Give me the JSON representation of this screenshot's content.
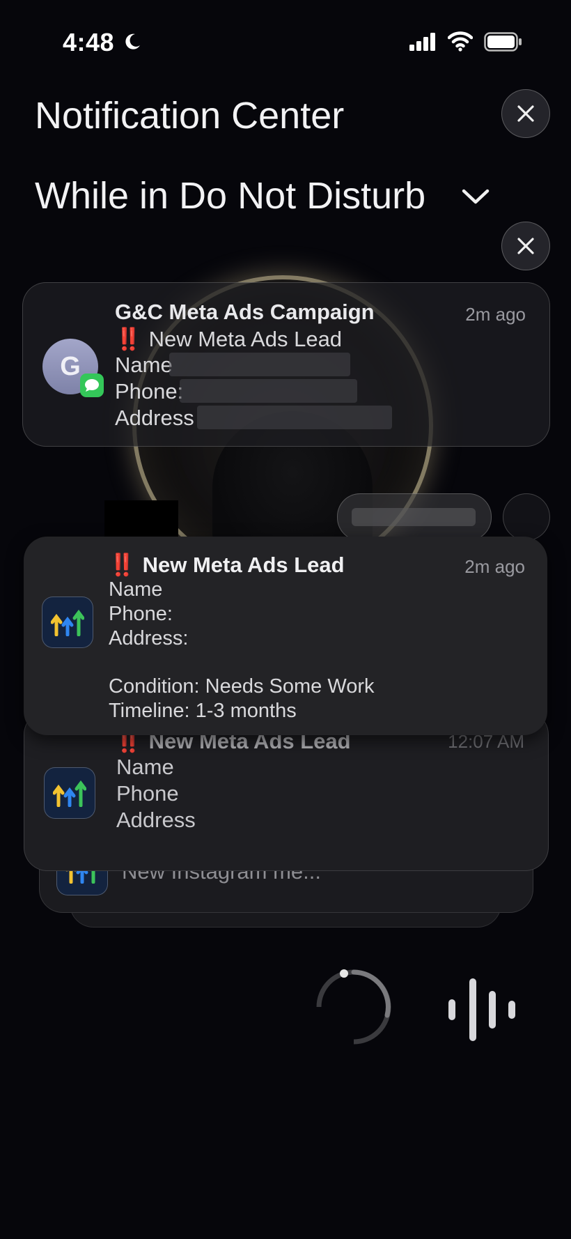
{
  "status_bar": {
    "time": "4:48",
    "focus_icon": "moon-icon",
    "signal_icon": "cellular-signal-icon",
    "wifi_icon": "wifi-icon",
    "battery_icon": "battery-icon"
  },
  "header": {
    "title": "Notification Center",
    "close_icon": "close-icon"
  },
  "section": {
    "title": "While in Do Not Disturb",
    "chevron_icon": "chevron-down-icon",
    "clear_icon": "close-icon"
  },
  "notifications": [
    {
      "app": "Messages",
      "avatar_letter": "G",
      "title": "G&C Meta Ads Campaign",
      "time": "2m ago",
      "urgent_mark": "‼️",
      "subtitle": "New Meta Ads Lead",
      "lines": [
        "Name",
        "Phone:",
        "Address"
      ]
    },
    {
      "app": "GoHighLevel",
      "urgent_mark": "‼️",
      "title": "New Meta Ads Lead",
      "time": "2m ago",
      "lines": [
        "Name",
        "Phone:",
        "Address:",
        "",
        "Condition: Needs Some Work",
        "Timeline: 1-3 months"
      ]
    },
    {
      "app": "GoHighLevel",
      "urgent_mark": "‼️",
      "title": "New Meta Ads Lead",
      "time": "12:07 AM",
      "lines": [
        "Name",
        "Phone",
        "Address"
      ]
    },
    {
      "app": "GoHighLevel",
      "title": "New Instagram me..."
    }
  ],
  "colors": {
    "background": "#06060b",
    "card": "#232326",
    "urgent": "#e0392f",
    "messages_badge": "#34c759",
    "avatar": "#8f93b8"
  },
  "bottom_controls": {
    "left_icon": "loading-spinner-icon",
    "right_icon": "waveform-icon"
  }
}
